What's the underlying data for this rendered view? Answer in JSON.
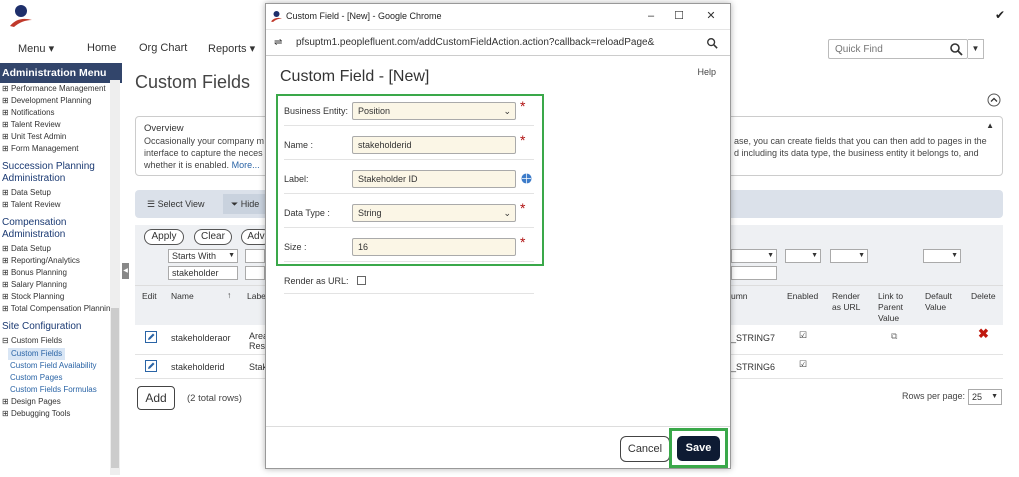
{
  "app": {
    "nav": [
      "Menu",
      "Home",
      "Org Chart",
      "Reports"
    ],
    "quick_find_placeholder": "Quick Find"
  },
  "sidebar": {
    "header": "Administration Menu",
    "items_top": [
      "Performance Management",
      "Development Planning",
      "Notifications",
      "Talent Review",
      "Unit Test Admin",
      "Form Management"
    ],
    "sections": [
      {
        "title": "Succession Planning Administration",
        "items": [
          "Data Setup",
          "Talent Review"
        ]
      },
      {
        "title": "Compensation Administration",
        "items": [
          "Data Setup",
          "Reporting/Analytics",
          "Bonus Planning",
          "Salary Planning",
          "Stock Planning",
          "Total Compensation Planning"
        ]
      },
      {
        "title": "Site Configuration",
        "items": [
          "Custom Fields"
        ]
      }
    ],
    "site_sub": [
      "Custom Fields",
      "Custom Field Availability",
      "Custom Pages",
      "Custom Fields Formulas"
    ],
    "items_bottom": [
      "Design Pages",
      "Debugging Tools"
    ]
  },
  "main": {
    "title": "Custom Fields",
    "overview_title": "Overview",
    "overview_text_left": "Occasionally your company m",
    "overview_text_left2": "interface to capture the neces",
    "overview_text_left3": "whether it is enabled.",
    "overview_more": "More...",
    "overview_text_right": "ase, you can create fields that you can then add to pages in the",
    "overview_text_right2": "d including its data type, the business entity it belongs to, and",
    "select_view": "Select View",
    "hide": "Hide",
    "apply": "Apply",
    "clear": "Clear",
    "adv": "Adv",
    "filter_mode": "Starts With",
    "filter_value": "stakeholder",
    "columns": {
      "edit": "Edit",
      "name": "Name",
      "label": "Labe",
      "column": "umn",
      "enabled": "Enabled",
      "render_url": "Render as URL",
      "link_parent": "Link to Parent Value",
      "default_value": "Default Value",
      "delete": "Delete"
    },
    "rows": [
      {
        "name": "stakeholderaor",
        "label": "Area Resp",
        "column": "_STRING7"
      },
      {
        "name": "stakeholderid",
        "label": "Stak",
        "column": "_STRING6"
      }
    ],
    "add": "Add",
    "total_rows": "(2 total rows)",
    "rows_per_page_label": "Rows per page:",
    "rows_per_page": "25"
  },
  "popup": {
    "window_title": "Custom Field - [New] - Google Chrome",
    "url": "pfsuptm1.peoplefluent.com/addCustomFieldAction.action?callback=reloadPage&",
    "heading": "Custom Field - [New]",
    "help": "Help",
    "fields": [
      {
        "label": "Business Entity:",
        "value": "Position",
        "type": "select"
      },
      {
        "label": "Name :",
        "value": "stakeholderid",
        "type": "text"
      },
      {
        "label": "Label:",
        "value": "Stakeholder ID",
        "type": "text"
      },
      {
        "label": "Data Type :",
        "value": "String",
        "type": "select"
      },
      {
        "label": "Size :",
        "value": "16",
        "type": "text"
      }
    ],
    "render_as_url": "Render as URL:",
    "cancel": "Cancel",
    "save": "Save"
  },
  "colors": {
    "accent_green": "#3aa84a",
    "save_bg": "#0e1b33",
    "sidebar_header": "#32456b",
    "required": "#b01010"
  }
}
